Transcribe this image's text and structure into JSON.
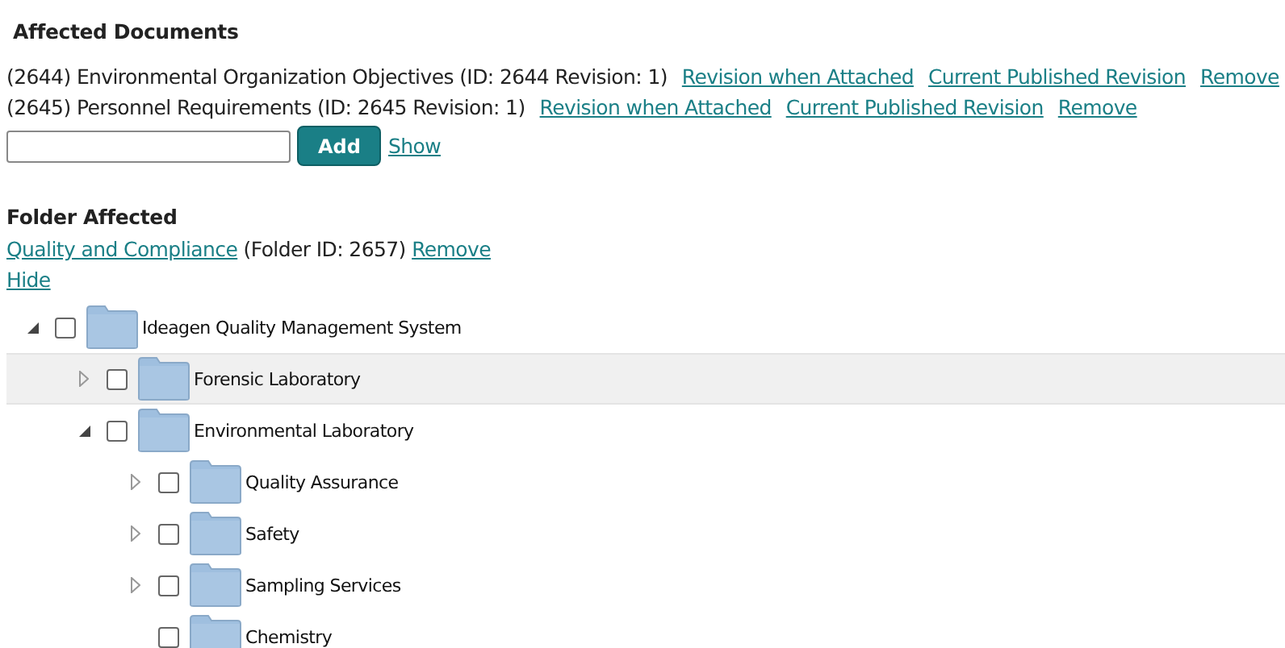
{
  "documents_section": {
    "title": "Affected Documents",
    "documents": [
      {
        "text": "(2644) Environmental Organization Objectives (ID: 2644 Revision: 1)",
        "links": [
          "Revision when Attached",
          "Current Published Revision",
          "Remove"
        ]
      },
      {
        "text": "(2645) Personnel Requirements (ID: 2645 Revision: 1)",
        "links": [
          "Revision when Attached",
          "Current Published Revision",
          "Remove"
        ]
      }
    ],
    "add_button": "Add",
    "show_link": "Show"
  },
  "folder_section": {
    "title": "Folder Affected",
    "folder_link": "Quality and Compliance",
    "folder_info": "(Folder ID: 2657)",
    "remove_link": "Remove",
    "hide_link": "Hide"
  },
  "tree": [
    {
      "label": "Ideagen Quality Management System",
      "kind": "branch",
      "expanded": true,
      "checked": false,
      "selected": false,
      "children": [
        {
          "label": "Forensic Laboratory",
          "kind": "branch",
          "expanded": false,
          "checked": false,
          "selected": true
        },
        {
          "label": "Environmental Laboratory",
          "kind": "branch",
          "expanded": true,
          "checked": false,
          "selected": false,
          "children": [
            {
              "label": "Quality Assurance",
              "kind": "branch",
              "expanded": false,
              "checked": false,
              "selected": false
            },
            {
              "label": "Safety",
              "kind": "branch",
              "expanded": false,
              "checked": false,
              "selected": false
            },
            {
              "label": "Sampling Services",
              "kind": "branch",
              "expanded": false,
              "checked": false,
              "selected": false
            },
            {
              "label": "Chemistry",
              "kind": "leaf",
              "checked": false,
              "selected": false
            }
          ]
        }
      ]
    }
  ]
}
